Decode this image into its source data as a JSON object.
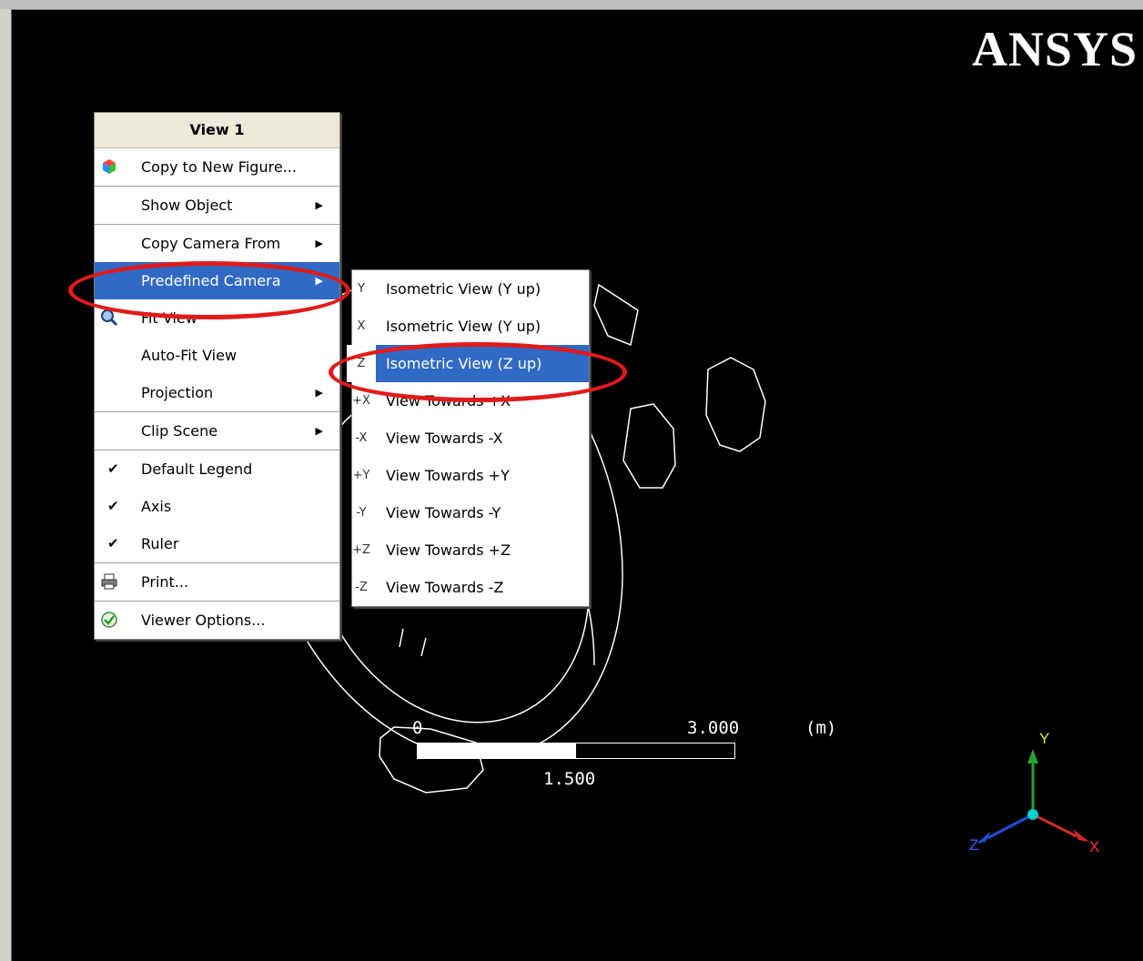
{
  "logo": "ANSYS",
  "context_menu": {
    "title": "View 1",
    "items": [
      {
        "label": "Copy to New Figure..."
      },
      {
        "label": "Show Object"
      },
      {
        "label": "Copy Camera From"
      },
      {
        "label": "Predefined Camera"
      },
      {
        "label": "Fit View"
      },
      {
        "label": "Auto-Fit View"
      },
      {
        "label": "Projection"
      },
      {
        "label": "Clip Scene"
      },
      {
        "label": "Default Legend"
      },
      {
        "label": "Axis"
      },
      {
        "label": "Ruler"
      },
      {
        "label": "Print..."
      },
      {
        "label": "Viewer Options..."
      }
    ]
  },
  "camera_submenu": {
    "items": [
      {
        "icon_text": "Y",
        "label": "Isometric View (Y up)"
      },
      {
        "icon_text": "X",
        "label": "Isometric View (Y up)"
      },
      {
        "icon_text": "Z",
        "label": "Isometric View (Z up)"
      },
      {
        "icon_text": "+X",
        "label": "View Towards +X"
      },
      {
        "icon_text": "-X",
        "label": "View Towards -X"
      },
      {
        "icon_text": "+Y",
        "label": "View Towards +Y"
      },
      {
        "icon_text": "-Y",
        "label": "View Towards -Y"
      },
      {
        "icon_text": "+Z",
        "label": "View Towards +Z"
      },
      {
        "icon_text": "-Z",
        "label": "View Towards -Z"
      }
    ]
  },
  "ruler": {
    "start": "0",
    "end": "3.000",
    "unit": "(m)",
    "mid": "1.500"
  },
  "axis": {
    "y": "Y",
    "x": "X",
    "z": "Z"
  },
  "colors": {
    "highlight": "#316ac5",
    "annotation": "#e31a1a",
    "axis_y": "#2ca02c",
    "axis_x": "#d62728",
    "axis_z": "#1f4fd6"
  }
}
